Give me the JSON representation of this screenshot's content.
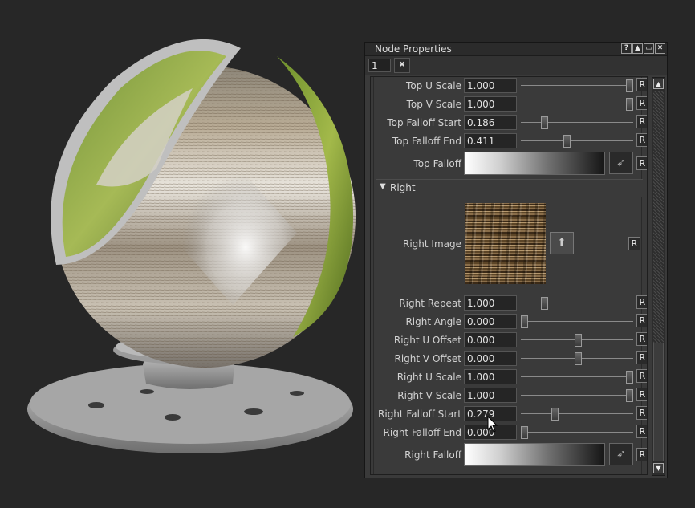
{
  "panel": {
    "title": "Node Properties",
    "window_controls": [
      "?",
      "▲",
      "▭",
      "✕"
    ],
    "node_index": "1",
    "pin_icon": "pin-icon"
  },
  "top_section": {
    "rows": [
      {
        "label": "Top U Scale",
        "value": "1.000",
        "slider_fraction": 0.965
      },
      {
        "label": "Top V Scale",
        "value": "1.000",
        "slider_fraction": 0.965
      },
      {
        "label": "Top Falloff Start",
        "value": "0.186",
        "slider_fraction": 0.21
      },
      {
        "label": "Top Falloff End",
        "value": "0.411",
        "slider_fraction": 0.41
      }
    ],
    "falloff_label": "Top Falloff"
  },
  "right_section": {
    "header": "Right",
    "image_label": "Right Image",
    "rows": [
      {
        "label": "Right Repeat",
        "value": "1.000",
        "slider_fraction": 0.21
      },
      {
        "label": "Right Angle",
        "value": "0.000",
        "slider_fraction": 0.03
      },
      {
        "label": "Right U Offset",
        "value": "0.000",
        "slider_fraction": 0.51
      },
      {
        "label": "Right V Offset",
        "value": "0.000",
        "slider_fraction": 0.51
      },
      {
        "label": "Right U Scale",
        "value": "1.000",
        "slider_fraction": 0.965
      },
      {
        "label": "Right V Scale",
        "value": "1.000",
        "slider_fraction": 0.965
      },
      {
        "label": "Right Falloff Start",
        "value": "0.279",
        "slider_fraction": 0.3
      },
      {
        "label": "Right Falloff End",
        "value": "0.000",
        "slider_fraction": 0.03
      }
    ],
    "falloff_label": "Right Falloff"
  },
  "reset_label": "R",
  "colors": {
    "background": "#272727",
    "panel": "#3a3a3a",
    "field": "#252525"
  }
}
